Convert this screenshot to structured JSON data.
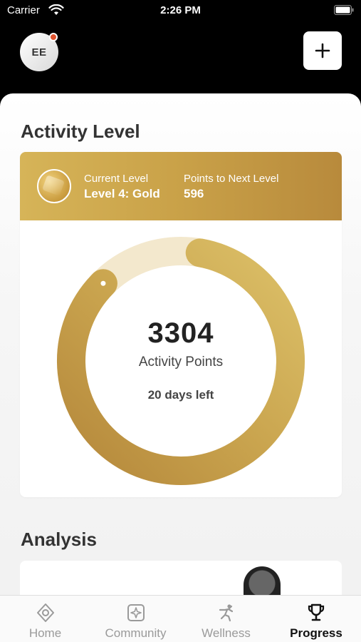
{
  "status_bar": {
    "carrier": "Carrier",
    "time": "2:26 PM"
  },
  "header": {
    "avatar_initials": "EE"
  },
  "activity": {
    "section_title": "Activity Level",
    "current_level_label": "Current Level",
    "current_level_value": "Level 4: Gold",
    "next_level_label": "Points to Next Level",
    "next_level_value": "596",
    "points": "3304",
    "points_label": "Activity Points",
    "days_left": "20 days left",
    "progress_fraction": 0.847
  },
  "analysis": {
    "section_title": "Analysis"
  },
  "tabs": [
    {
      "label": "Home",
      "icon": "home-icon",
      "active": false
    },
    {
      "label": "Community",
      "icon": "community-icon",
      "active": false
    },
    {
      "label": "Wellness",
      "icon": "wellness-icon",
      "active": false
    },
    {
      "label": "Progress",
      "icon": "trophy-icon",
      "active": true
    }
  ],
  "colors": {
    "gold_light": "#d8b95c",
    "gold_dark": "#b88a3c",
    "track": "#f3e8cd",
    "notification": "#e0532e"
  }
}
